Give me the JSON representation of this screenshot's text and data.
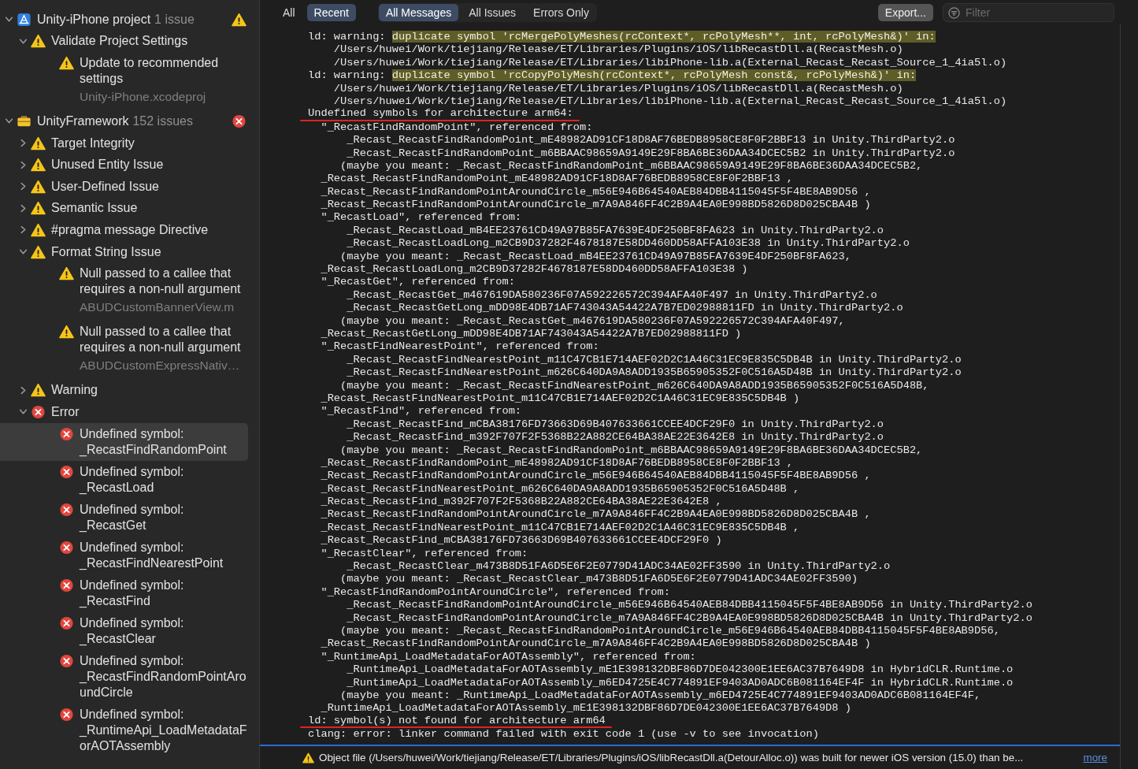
{
  "sidebar": {
    "tree": [
      {
        "kind": "project",
        "label": "Unity-iPhone project",
        "count": "1 issue",
        "has_errors": false,
        "expanded": true,
        "selected": false,
        "children": [
          {
            "kind": "group",
            "error": false,
            "label": "Validate Project Settings",
            "expanded": true,
            "selected": false,
            "children": [
              {
                "kind": "issue",
                "error": false,
                "label": "Update to recommended settings",
                "file": "Unity-iPhone.xcodeproj",
                "selected": false
              }
            ]
          }
        ]
      },
      {
        "kind": "target",
        "label": "UnityFramework",
        "count": "152 issues",
        "has_errors": true,
        "expanded": true,
        "selected": false,
        "children": [
          {
            "kind": "group",
            "error": false,
            "label": "Target Integrity",
            "expanded": false,
            "selected": false
          },
          {
            "kind": "group",
            "error": false,
            "label": "Unused Entity Issue",
            "expanded": false,
            "selected": false
          },
          {
            "kind": "group",
            "error": false,
            "label": "User-Defined Issue",
            "expanded": false,
            "selected": false
          },
          {
            "kind": "group",
            "error": false,
            "label": "Semantic Issue",
            "expanded": false,
            "selected": false
          },
          {
            "kind": "group",
            "error": false,
            "label": "#pragma message Directive",
            "expanded": false,
            "selected": false
          },
          {
            "kind": "group",
            "error": false,
            "label": "Format String Issue",
            "expanded": true,
            "selected": false,
            "children": [
              {
                "kind": "issue",
                "error": false,
                "label": "Null passed to a callee that requires a non-null argument",
                "file": "ABUDCustomBannerView.m",
                "selected": false
              },
              {
                "kind": "issue",
                "error": false,
                "label": "Null passed to a callee that requires a non-null argument",
                "file": "ABUDCustomExpressNativ…",
                "selected": false
              }
            ]
          },
          {
            "kind": "group",
            "error": false,
            "label": "Warning",
            "expanded": false,
            "selected": false
          },
          {
            "kind": "group",
            "error": true,
            "label": "Error",
            "expanded": true,
            "selected": false,
            "children": [
              {
                "kind": "issue",
                "error": true,
                "label": "Undefined symbol: _RecastFindRandomPoint",
                "selected": true
              },
              {
                "kind": "issue",
                "error": true,
                "label": "Undefined symbol: _RecastLoad",
                "selected": false
              },
              {
                "kind": "issue",
                "error": true,
                "label": "Undefined symbol: _RecastGet",
                "selected": false
              },
              {
                "kind": "issue",
                "error": true,
                "label": "Undefined symbol: _RecastFindNearestPoint",
                "selected": false
              },
              {
                "kind": "issue",
                "error": true,
                "label": "Undefined symbol: _RecastFind",
                "selected": false
              },
              {
                "kind": "issue",
                "error": true,
                "label": "Undefined symbol: _RecastClear",
                "selected": false
              },
              {
                "kind": "issue",
                "error": true,
                "label": "Undefined symbol: _RecastFindRandomPointAroundCircle",
                "selected": false
              },
              {
                "kind": "issue",
                "error": true,
                "label": "Undefined symbol: _RuntimeApi_LoadMetadataForAOTAssembly",
                "selected": false
              }
            ]
          }
        ]
      }
    ]
  },
  "toolbar": {
    "scope_tabs": [
      {
        "label": "All",
        "selected": false
      },
      {
        "label": "Recent",
        "selected": true
      }
    ],
    "filter_tabs": [
      {
        "label": "All Messages",
        "selected": true
      },
      {
        "label": "All Issues",
        "selected": false
      },
      {
        "label": "Errors Only",
        "selected": false
      }
    ],
    "export_button": "Export...",
    "filter": {
      "placeholder": "Filter"
    }
  },
  "log": {
    "lines": [
      {
        "kind": "warning",
        "prefix": "ld: warning:",
        "highlight": "duplicate symbol 'rcMergePolyMeshes(rcContext*, rcPolyMesh**, int, rcPolyMesh&)' in:"
      },
      {
        "kind": "plain",
        "text": "    /Users/huwei/Work/tiejiang/Release/ET/Libraries/Plugins/iOS/libRecastDll.a(RecastMesh.o)"
      },
      {
        "kind": "plain",
        "text": "    /Users/huwei/Work/tiejiang/Release/ET/Libraries/libiPhone-lib.a(External_Recast_Recast_Source_1_4ia5l.o)"
      },
      {
        "kind": "warning",
        "prefix": "ld: warning:",
        "highlight": "duplicate symbol 'rcCopyPolyMesh(rcContext*, rcPolyMesh const&, rcPolyMesh&)' in:"
      },
      {
        "kind": "plain",
        "text": "    /Users/huwei/Work/tiejiang/Release/ET/Libraries/Plugins/iOS/libRecastDll.a(RecastMesh.o)"
      },
      {
        "kind": "plain",
        "text": "    /Users/huwei/Work/tiejiang/Release/ET/Libraries/libiPhone-lib.a(External_Recast_Recast_Source_1_4ia5l.o)"
      },
      {
        "kind": "underlined",
        "text": "Undefined symbols for architecture arm64:"
      },
      {
        "kind": "plain",
        "text": "  \"_RecastFindRandomPoint\", referenced from:"
      },
      {
        "kind": "plain",
        "text": "      _Recast_RecastFindRandomPoint_mE48982AD91CF18D8AF76BEDB8958CE8F0F2BBF13 in Unity.ThirdParty2.o"
      },
      {
        "kind": "plain",
        "text": "      _Recast_RecastFindRandomPoint_m6BBAAC98659A9149E29F8BA6BE36DAA34DCEC5B2 in Unity.ThirdParty2.o"
      },
      {
        "kind": "plain",
        "text": "     (maybe you meant: _Recast_RecastFindRandomPoint_m6BBAAC98659A9149E29F8BA6BE36DAA34DCEC5B2,"
      },
      {
        "kind": "plain",
        "text": "  _Recast_RecastFindRandomPoint_mE48982AD91CF18D8AF76BEDB8958CE8F0F2BBF13 ,"
      },
      {
        "kind": "plain",
        "text": "  _Recast_RecastFindRandomPointAroundCircle_m56E946B64540AEB84DBB4115045F5F4BE8AB9D56 ,"
      },
      {
        "kind": "plain",
        "text": "  _Recast_RecastFindRandomPointAroundCircle_m7A9A846FF4C2B9A4EA0E998BD5826D8D025CBA4B )"
      },
      {
        "kind": "plain",
        "text": "  \"_RecastLoad\", referenced from:"
      },
      {
        "kind": "plain",
        "text": "      _Recast_RecastLoad_mB4EE23761CD49A97B85FA7639E4DF250BF8FA623 in Unity.ThirdParty2.o"
      },
      {
        "kind": "plain",
        "text": "      _Recast_RecastLoadLong_m2CB9D37282F4678187E58DD460DD58AFFA103E38 in Unity.ThirdParty2.o"
      },
      {
        "kind": "plain",
        "text": "     (maybe you meant: _Recast_RecastLoad_mB4EE23761CD49A97B85FA7639E4DF250BF8FA623,"
      },
      {
        "kind": "plain",
        "text": "  _Recast_RecastLoadLong_m2CB9D37282F4678187E58DD460DD58AFFA103E38 )"
      },
      {
        "kind": "plain",
        "text": "  \"_RecastGet\", referenced from:"
      },
      {
        "kind": "plain",
        "text": "      _Recast_RecastGet_m467619DA580236F07A592226572C394AFA40F497 in Unity.ThirdParty2.o"
      },
      {
        "kind": "plain",
        "text": "      _Recast_RecastGetLong_mDD98E4DB71AF743043A54422A7B7ED02988811FD in Unity.ThirdParty2.o"
      },
      {
        "kind": "plain",
        "text": "     (maybe you meant: _Recast_RecastGet_m467619DA580236F07A592226572C394AFA40F497,"
      },
      {
        "kind": "plain",
        "text": "  _Recast_RecastGetLong_mDD98E4DB71AF743043A54422A7B7ED02988811FD )"
      },
      {
        "kind": "plain",
        "text": "  \"_RecastFindNearestPoint\", referenced from:"
      },
      {
        "kind": "plain",
        "text": "      _Recast_RecastFindNearestPoint_m11C47CB1E714AEF02D2C1A46C31EC9E835C5DB4B in Unity.ThirdParty2.o"
      },
      {
        "kind": "plain",
        "text": "      _Recast_RecastFindNearestPoint_m626C640DA9A8ADD1935B65905352F0C516A5D48B in Unity.ThirdParty2.o"
      },
      {
        "kind": "plain",
        "text": "     (maybe you meant: _Recast_RecastFindNearestPoint_m626C640DA9A8ADD1935B65905352F0C516A5D48B,"
      },
      {
        "kind": "plain",
        "text": "  _Recast_RecastFindNearestPoint_m11C47CB1E714AEF02D2C1A46C31EC9E835C5DB4B )"
      },
      {
        "kind": "plain",
        "text": "  \"_RecastFind\", referenced from:"
      },
      {
        "kind": "plain",
        "text": "      _Recast_RecastFind_mCBA38176FD73663D69B407633661CCEE4DCF29F0 in Unity.ThirdParty2.o"
      },
      {
        "kind": "plain",
        "text": "      _Recast_RecastFind_m392F707F2F5368B22A882CE64BA38AE22E3642E8 in Unity.ThirdParty2.o"
      },
      {
        "kind": "plain",
        "text": "     (maybe you meant: _Recast_RecastFindRandomPoint_m6BBAAC98659A9149E29F8BA6BE36DAA34DCEC5B2,"
      },
      {
        "kind": "plain",
        "text": "  _Recast_RecastFindRandomPoint_mE48982AD91CF18D8AF76BEDB8958CE8F0F2BBF13 ,"
      },
      {
        "kind": "plain",
        "text": "  _Recast_RecastFindRandomPointAroundCircle_m56E946B64540AEB84DBB4115045F5F4BE8AB9D56 ,"
      },
      {
        "kind": "plain",
        "text": "  _Recast_RecastFindNearestPoint_m626C640DA9A8ADD1935B65905352F0C516A5D48B ,"
      },
      {
        "kind": "plain",
        "text": "  _Recast_RecastFind_m392F707F2F5368B22A882CE64BA38AE22E3642E8 ,"
      },
      {
        "kind": "plain",
        "text": "  _Recast_RecastFindRandomPointAroundCircle_m7A9A846FF4C2B9A4EA0E998BD5826D8D025CBA4B ,"
      },
      {
        "kind": "plain",
        "text": "  _Recast_RecastFindNearestPoint_m11C47CB1E714AEF02D2C1A46C31EC9E835C5DB4B ,"
      },
      {
        "kind": "plain",
        "text": "  _Recast_RecastFind_mCBA38176FD73663D69B407633661CCEE4DCF29F0 )"
      },
      {
        "kind": "plain",
        "text": "  \"_RecastClear\", referenced from:"
      },
      {
        "kind": "plain",
        "text": "      _Recast_RecastClear_m473B8D51FA6D5E6F2E0779D41ADC34AE02FF3590 in Unity.ThirdParty2.o"
      },
      {
        "kind": "plain",
        "text": "     (maybe you meant: _Recast_RecastClear_m473B8D51FA6D5E6F2E0779D41ADC34AE02FF3590)"
      },
      {
        "kind": "plain",
        "text": "  \"_RecastFindRandomPointAroundCircle\", referenced from:"
      },
      {
        "kind": "plain",
        "text": "      _Recast_RecastFindRandomPointAroundCircle_m56E946B64540AEB84DBB4115045F5F4BE8AB9D56 in Unity.ThirdParty2.o"
      },
      {
        "kind": "plain",
        "text": "      _Recast_RecastFindRandomPointAroundCircle_m7A9A846FF4C2B9A4EA0E998BD5826D8D025CBA4B in Unity.ThirdParty2.o"
      },
      {
        "kind": "plain",
        "text": "     (maybe you meant: _Recast_RecastFindRandomPointAroundCircle_m56E946B64540AEB84DBB4115045F5F4BE8AB9D56,"
      },
      {
        "kind": "plain",
        "text": "  _Recast_RecastFindRandomPointAroundCircle_m7A9A846FF4C2B9A4EA0E998BD5826D8D025CBA4B )"
      },
      {
        "kind": "plain",
        "text": "  \"_RuntimeApi_LoadMetadataForAOTAssembly\", referenced from:"
      },
      {
        "kind": "plain",
        "text": "      _RuntimeApi_LoadMetadataForAOTAssembly_mE1E398132DBF86D7DE042300E1EE6AC37B7649D8 in HybridCLR.Runtime.o"
      },
      {
        "kind": "plain",
        "text": "      _RuntimeApi_LoadMetadataForAOTAssembly_m6ED4725E4C774891EF9403AD0ADC6B081164EF4F in HybridCLR.Runtime.o"
      },
      {
        "kind": "plain",
        "text": "     (maybe you meant: _RuntimeApi_LoadMetadataForAOTAssembly_m6ED4725E4C774891EF9403AD0ADC6B081164EF4F,"
      },
      {
        "kind": "plain",
        "text": "  _RuntimeApi_LoadMetadataForAOTAssembly_mE1E398132DBF86D7DE042300E1EE6AC37B7649D8 )"
      },
      {
        "kind": "underlined",
        "text": "ld: symbol(s) not found for architecture arm64"
      },
      {
        "kind": "plain",
        "text": "clang: error: linker command failed with exit code 1 (use -v to see invocation)"
      }
    ]
  },
  "status_bar": {
    "error": false,
    "message": "Object file (/Users/huwei/Work/tiejiang/Release/ET/Libraries/Plugins/iOS/libRecastDll.a(DetourAlloc.o)) was built for newer iOS version (15.0) than be...",
    "link": "more"
  }
}
